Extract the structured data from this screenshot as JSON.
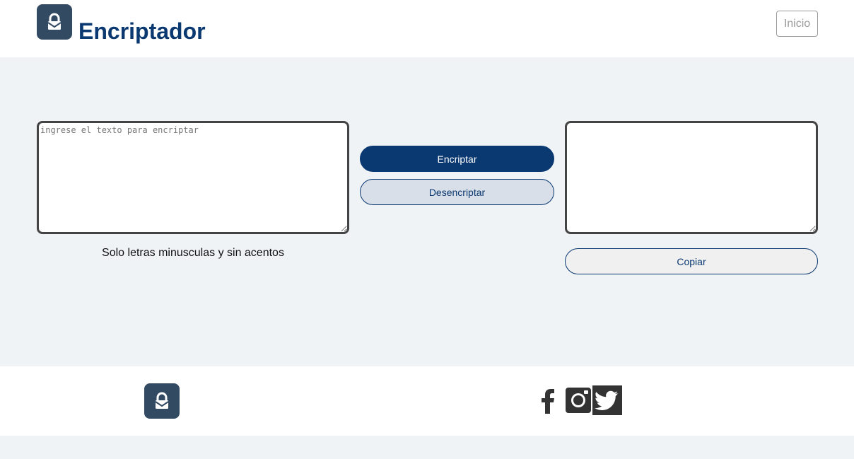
{
  "header": {
    "title": "Encriptador",
    "logo_icon": "lock-icon",
    "inicio_label": "Inicio"
  },
  "main": {
    "input": {
      "placeholder": "ingrese el texto para encriptar",
      "value": ""
    },
    "hint": "Solo letras minusculas y sin acentos",
    "encrypt_label": "Encriptar",
    "decrypt_label": "Desencriptar",
    "output": {
      "value": ""
    },
    "copy_label": "Copiar"
  },
  "footer": {
    "logo_icon": "lock-icon",
    "social": [
      "facebook-icon",
      "instagram-icon",
      "twitter-icon"
    ]
  },
  "colors": {
    "brand": "#0a3871",
    "logo_bg": "#334a63",
    "page_bg": "#f0f3f6",
    "secondary_button_bg": "#d8dfe8"
  }
}
